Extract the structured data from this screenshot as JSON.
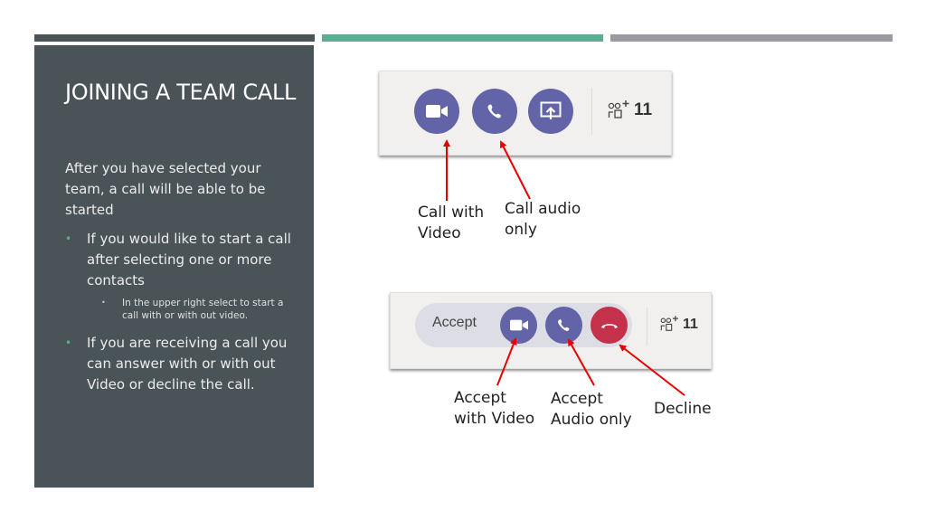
{
  "slide": {
    "title": "JOINING A TEAM CALL",
    "intro": "After you have selected your team, a call will be able to be started",
    "bullets": [
      {
        "text": "If you would like to start a call after selecting one or more contacts",
        "sub": "In the upper right select to start a call with or with out video."
      },
      {
        "text": "If you are receiving a call you can answer with or with out Video or decline the call."
      }
    ],
    "bullet_glyph": "•"
  },
  "call_toolbar": {
    "buttons": [
      {
        "name": "video-call",
        "icon": "video-camera-icon"
      },
      {
        "name": "audio-call",
        "icon": "phone-icon"
      },
      {
        "name": "share-screen",
        "icon": "share-screen-icon"
      }
    ],
    "participants_icon": "add-people-icon",
    "participants_count": "11"
  },
  "incoming_toolbar": {
    "accept_label": "Accept",
    "buttons": [
      {
        "name": "accept-video",
        "icon": "video-camera-icon"
      },
      {
        "name": "accept-audio",
        "icon": "phone-icon"
      },
      {
        "name": "decline",
        "icon": "hang-up-icon"
      }
    ],
    "participants_count": "11"
  },
  "annotations": {
    "call_with_video": [
      "Call with",
      "Video"
    ],
    "call_audio_only": [
      "Call audio",
      "only"
    ],
    "accept_with_video": [
      "Accept",
      "with Video"
    ],
    "accept_audio_only": [
      "Accept",
      "Audio only"
    ],
    "decline": "Decline"
  },
  "colors": {
    "accent_teal": "#5fac92",
    "panel_dark": "#4a5357",
    "teams_purple": "#6264a7",
    "decline_red": "#c4314b",
    "arrow_red": "#e60000"
  }
}
